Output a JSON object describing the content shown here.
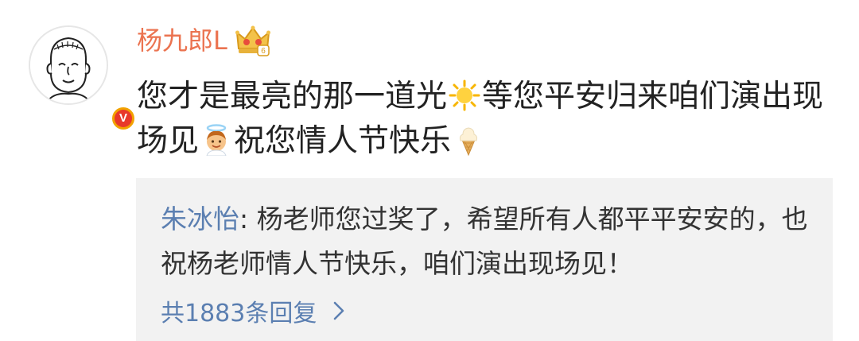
{
  "comment": {
    "username": "杨九郎L",
    "level_badge_number": "6",
    "content_segments": [
      {
        "type": "text",
        "value": "您才是最亮的那一道光"
      },
      {
        "type": "emoji",
        "name": "sun-emoji"
      },
      {
        "type": "text",
        "value": "等您平安归来咱们演出现场见"
      },
      {
        "type": "emoji",
        "name": "angel-emoji"
      },
      {
        "type": "text",
        "value": "祝您情人节快乐"
      },
      {
        "type": "emoji",
        "name": "ice-cream-emoji"
      }
    ],
    "verified_badge": "V"
  },
  "reply": {
    "author": "朱冰怡",
    "separator": ": ",
    "text": "杨老师您过奖了，希望所有人都平平安安的，也祝杨老师情人节快乐，咱们演出现场见！",
    "reply_count_label": "共1883条回复"
  },
  "colors": {
    "username": "#eb7350",
    "link": "#5b7fb1",
    "reply_bg": "#f2f2f2",
    "text": "#222222"
  }
}
